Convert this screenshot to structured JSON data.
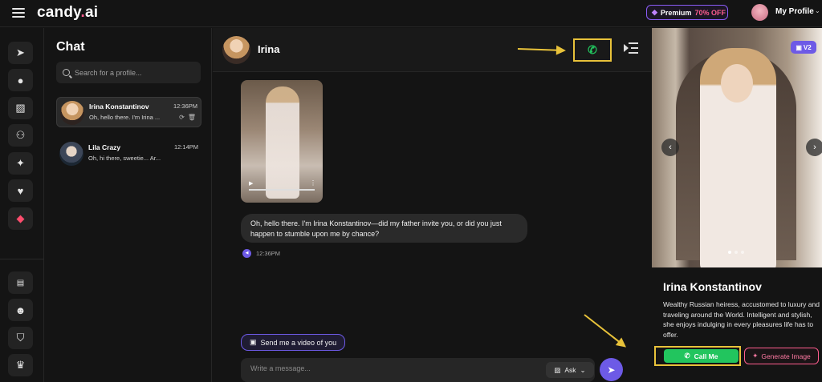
{
  "app": {
    "logo_main": "candy",
    "logo_dot": ".",
    "logo_suffix": "ai"
  },
  "topbar": {
    "premium_label": "Premium",
    "premium_discount": "70% OFF",
    "profile_label": "My Profile"
  },
  "rail": {
    "items": [
      {
        "icon": "compass-icon"
      },
      {
        "icon": "chat-icon"
      },
      {
        "icon": "gallery-icon"
      },
      {
        "icon": "create-character-icon"
      },
      {
        "icon": "magic-wand-icon"
      },
      {
        "icon": "heart-icon"
      },
      {
        "icon": "diamond-icon",
        "color": "#ff4d6d"
      },
      {
        "icon": "us-flag-icon"
      },
      {
        "icon": "discord-icon"
      },
      {
        "icon": "shield-icon"
      },
      {
        "icon": "trophy-icon"
      }
    ]
  },
  "chatlist": {
    "title": "Chat",
    "search_placeholder": "Search for a profile...",
    "items": [
      {
        "name": "Irina Konstantinov",
        "time": "12:36PM",
        "preview": "Oh, hello there. I'm Irina ...",
        "active": true
      },
      {
        "name": "Lila Crazy",
        "time": "12:14PM",
        "preview": "Oh, hi there, sweetie... Ar...",
        "active": false
      }
    ]
  },
  "main": {
    "contact_name": "Irina",
    "message_text": "Oh, hello there. I'm Irina Konstantinov—did my father invite you, or did you just happen to stumble upon me by chance?",
    "message_time": "12:36PM",
    "suggestion": "Send me a video of you",
    "input_placeholder": "Write a message...",
    "ask_label": "Ask"
  },
  "profile": {
    "badge": "V2",
    "name": "Irina Konstantinov",
    "bio": "Wealthy Russian heiress, accustomed to luxury and traveling around the World. Intelligent and stylish, she enjoys indulging in every pleasures life has to offer.",
    "call_button": "Call Me",
    "generate_button": "Generate Image"
  },
  "colors": {
    "accent_purple": "#6d5ae6",
    "call_green": "#22c55e",
    "brand_pink": "#ff5d8f",
    "annotation_yellow": "#e8c23a"
  }
}
